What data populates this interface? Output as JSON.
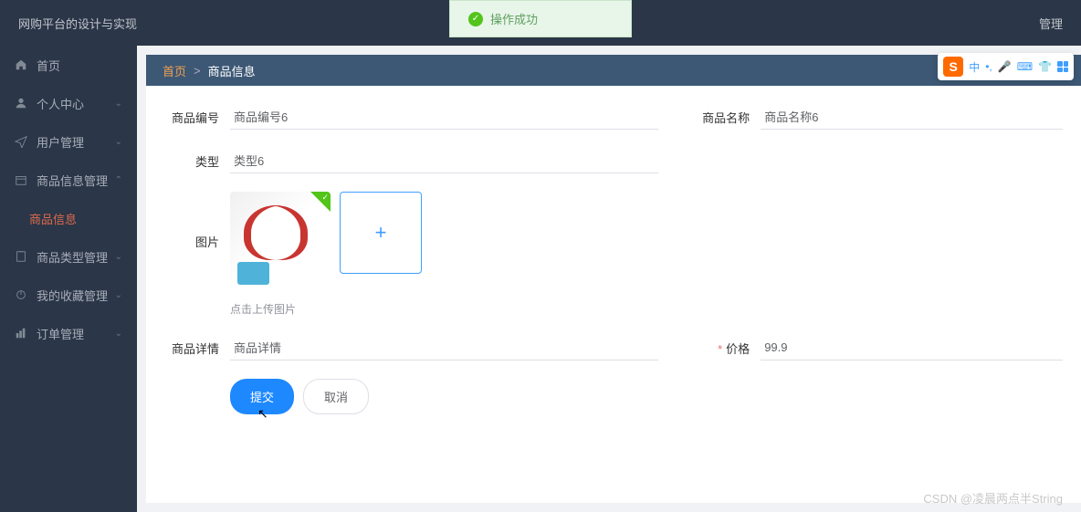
{
  "app": {
    "title": "网购平台的设计与实现"
  },
  "topbar": {
    "right_text": "管理"
  },
  "toast": {
    "text": "操作成功"
  },
  "sidebar": {
    "items": [
      {
        "label": "首页",
        "icon": "home",
        "expandable": false
      },
      {
        "label": "个人中心",
        "icon": "user",
        "expandable": true,
        "expanded": false
      },
      {
        "label": "用户管理",
        "icon": "send",
        "expandable": true,
        "expanded": false
      },
      {
        "label": "商品信息管理",
        "icon": "box",
        "expandable": true,
        "expanded": true,
        "children": [
          {
            "label": "商品信息"
          }
        ]
      },
      {
        "label": "商品类型管理",
        "icon": "clipboard",
        "expandable": true,
        "expanded": false
      },
      {
        "label": "我的收藏管理",
        "icon": "power",
        "expandable": true,
        "expanded": false
      },
      {
        "label": "订单管理",
        "icon": "chart",
        "expandable": true,
        "expanded": false
      }
    ]
  },
  "breadcrumb": {
    "home": "首页",
    "current": "商品信息"
  },
  "form": {
    "product_code": {
      "label": "商品编号",
      "value": "商品编号6"
    },
    "product_name": {
      "label": "商品名称",
      "value": "商品名称6"
    },
    "type": {
      "label": "类型",
      "value": "类型6"
    },
    "image": {
      "label": "图片",
      "hint": "点击上传图片"
    },
    "detail": {
      "label": "商品详情",
      "value": "商品详情"
    },
    "price": {
      "label": "价格",
      "value": "99.9"
    },
    "submit_label": "提交",
    "cancel_label": "取消"
  },
  "ime": {
    "lang": "中",
    "punct": "•,",
    "icons": [
      "mic",
      "keyboard",
      "shirt",
      "grid"
    ]
  },
  "watermark": "CSDN @凌晨两点半String"
}
